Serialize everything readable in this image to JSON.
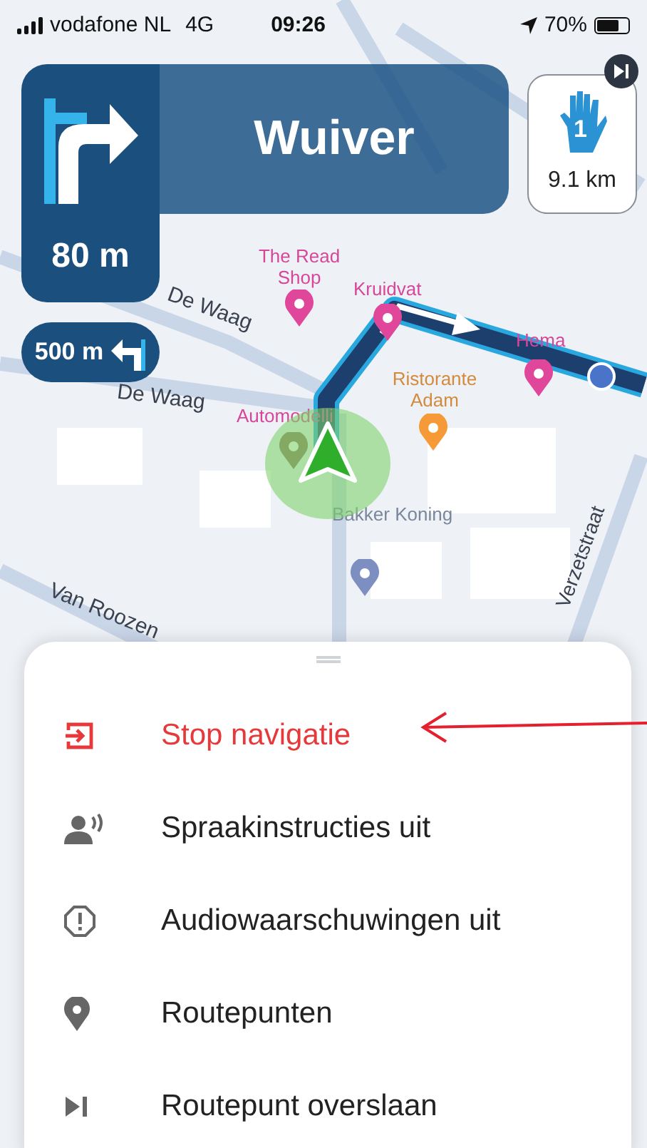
{
  "status_bar": {
    "carrier": "vodafone NL",
    "network": "4G",
    "time": "09:26",
    "battery": "70%"
  },
  "instruction": {
    "street": "Wuiver",
    "distance": "80 m"
  },
  "next_instruction": {
    "distance": "500 m"
  },
  "destination_card": {
    "number": "1",
    "distance": "9.1 km"
  },
  "map_labels": [
    {
      "text": "The Read Shop",
      "kind": "shop"
    },
    {
      "text": "Kruidvat",
      "kind": "shop"
    },
    {
      "text": "Hema",
      "kind": "shop"
    },
    {
      "text": "Ristorante Adam",
      "kind": "food"
    },
    {
      "text": "Automodelli",
      "kind": "hobby"
    },
    {
      "text": "Bakker Koning",
      "kind": "place"
    },
    {
      "text": "De Waag",
      "kind": "street"
    },
    {
      "text": "De Waag",
      "kind": "street"
    },
    {
      "text": "Van Roozen",
      "kind": "street"
    },
    {
      "text": "Verzetstraat",
      "kind": "street"
    }
  ],
  "menu": [
    {
      "label": "Stop navigatie",
      "kind": "stop"
    },
    {
      "label": "Spraakinstructies uit",
      "kind": "voice"
    },
    {
      "label": "Audiowaarschuwingen uit",
      "kind": "warning"
    },
    {
      "label": "Routepunten",
      "kind": "pin"
    },
    {
      "label": "Routepunt overslaan",
      "kind": "skip"
    }
  ]
}
